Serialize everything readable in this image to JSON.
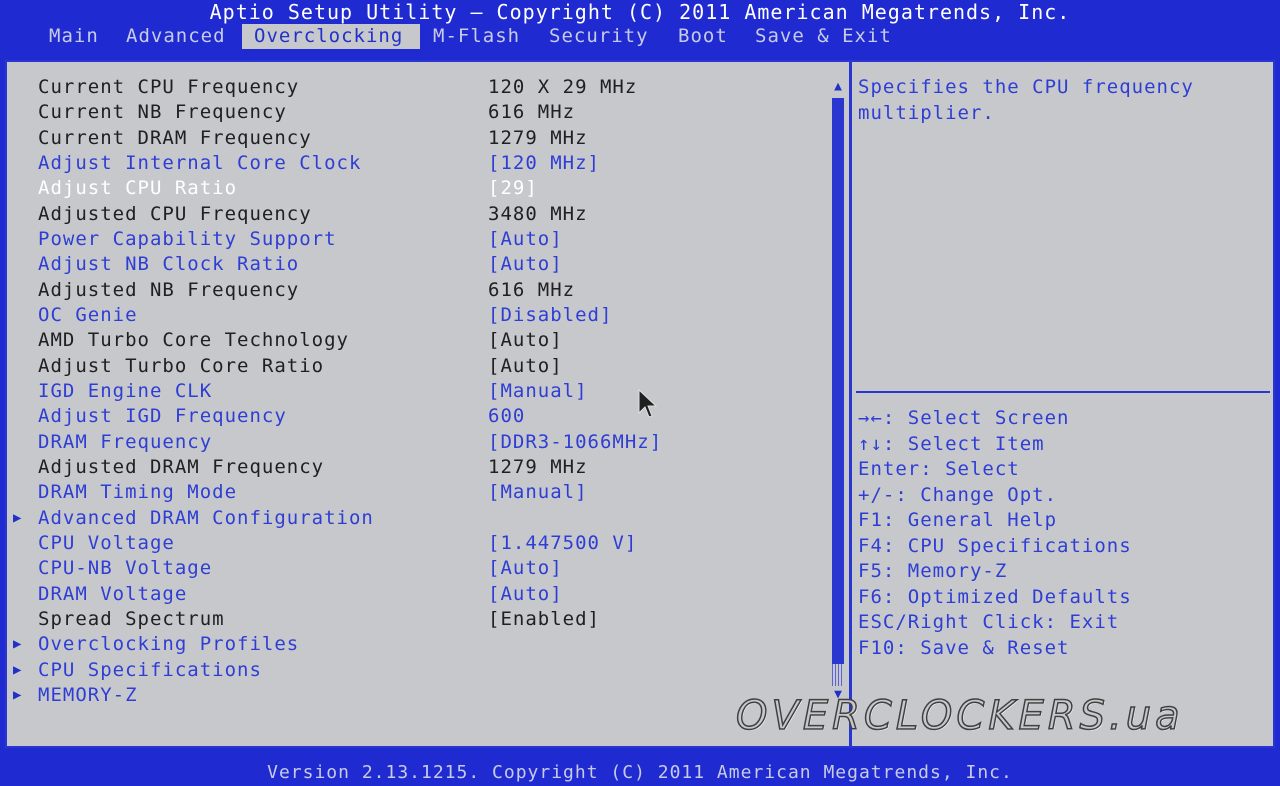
{
  "header": {
    "title": "Aptio Setup Utility – Copyright (C) 2011 American Megatrends, Inc."
  },
  "menu": {
    "tabs": [
      {
        "label": "Main",
        "active": false
      },
      {
        "label": "Advanced",
        "active": false
      },
      {
        "label": "Overclocking",
        "active": true
      },
      {
        "label": "M-Flash",
        "active": false
      },
      {
        "label": "Security",
        "active": false
      },
      {
        "label": "Boot",
        "active": false
      },
      {
        "label": "Save & Exit",
        "active": false
      }
    ]
  },
  "settings": [
    {
      "label": "Current CPU Frequency",
      "value": "120 X 29 MHz",
      "kind": "info",
      "submenu": false
    },
    {
      "label": "Current NB Frequency",
      "value": "616 MHz",
      "kind": "info",
      "submenu": false
    },
    {
      "label": "Current DRAM Frequency",
      "value": "1279 MHz",
      "kind": "info",
      "submenu": false
    },
    {
      "label": "Adjust Internal Core Clock",
      "value": "[120 MHz]",
      "kind": "option",
      "submenu": false
    },
    {
      "label": "Adjust CPU Ratio",
      "value": "[29]",
      "kind": "selected",
      "submenu": false
    },
    {
      "label": "Adjusted CPU Frequency",
      "value": "3480 MHz",
      "kind": "info",
      "submenu": false
    },
    {
      "label": "Power Capability Support",
      "value": "[Auto]",
      "kind": "option",
      "submenu": false
    },
    {
      "label": "Adjust NB Clock Ratio",
      "value": "[Auto]",
      "kind": "option",
      "submenu": false
    },
    {
      "label": "Adjusted NB Frequency",
      "value": "616 MHz",
      "kind": "info",
      "submenu": false
    },
    {
      "label": "OC Genie",
      "value": "[Disabled]",
      "kind": "option",
      "submenu": false
    },
    {
      "label": "AMD Turbo Core Technology",
      "value": "[Auto]",
      "kind": "info",
      "submenu": false
    },
    {
      "label": "Adjust Turbo Core Ratio",
      "value": "[Auto]",
      "kind": "info",
      "submenu": false
    },
    {
      "label": "IGD Engine CLK",
      "value": "[Manual]",
      "kind": "option",
      "submenu": false
    },
    {
      "label": "Adjust IGD Frequency",
      "value": "600",
      "kind": "option",
      "submenu": false
    },
    {
      "label": "DRAM Frequency",
      "value": "[DDR3-1066MHz]",
      "kind": "option",
      "submenu": false
    },
    {
      "label": "Adjusted DRAM Frequency",
      "value": "1279 MHz",
      "kind": "info",
      "submenu": false
    },
    {
      "label": "DRAM Timing Mode",
      "value": "[Manual]",
      "kind": "option",
      "submenu": false
    },
    {
      "label": "Advanced DRAM Configuration",
      "value": "",
      "kind": "option",
      "submenu": true
    },
    {
      "label": "CPU Voltage",
      "value": "[1.447500 V]",
      "kind": "option",
      "submenu": false
    },
    {
      "label": "CPU-NB Voltage",
      "value": "[Auto]",
      "kind": "option",
      "submenu": false
    },
    {
      "label": "DRAM Voltage",
      "value": "[Auto]",
      "kind": "option",
      "submenu": false
    },
    {
      "label": "Spread Spectrum",
      "value": "[Enabled]",
      "kind": "info",
      "submenu": false
    },
    {
      "label": "Overclocking Profiles",
      "value": "",
      "kind": "option",
      "submenu": true
    },
    {
      "label": "CPU Specifications",
      "value": "",
      "kind": "option",
      "submenu": true
    },
    {
      "label": "MEMORY-Z",
      "value": "",
      "kind": "option",
      "submenu": true
    }
  ],
  "help": {
    "line1": "Specifies the CPU frequency",
    "line2": "multiplier."
  },
  "keys": [
    "→←: Select Screen",
    "↑↓: Select Item",
    "Enter: Select",
    "+/-: Change Opt.",
    "F1: General Help",
    "F4: CPU Specifications",
    "F5: Memory-Z",
    "F6: Optimized Defaults",
    "ESC/Right Click: Exit",
    "F10: Save & Reset"
  ],
  "watermark": "OVERCLOCKERS.ua",
  "footer": {
    "text": "Version 2.13.1215. Copyright (C) 2011 American Megatrends, Inc."
  },
  "colors": {
    "background": "#1f2bd0",
    "panel": "#c7c8cc",
    "option_text": "#2e3ed4",
    "info_text": "#202020",
    "selected_text": "#ffffff"
  },
  "icons": {
    "submenu": "triangle-right",
    "scroll_up": "triangle-up",
    "scroll_down": "triangle-down",
    "pointer": "mouse-cursor"
  }
}
